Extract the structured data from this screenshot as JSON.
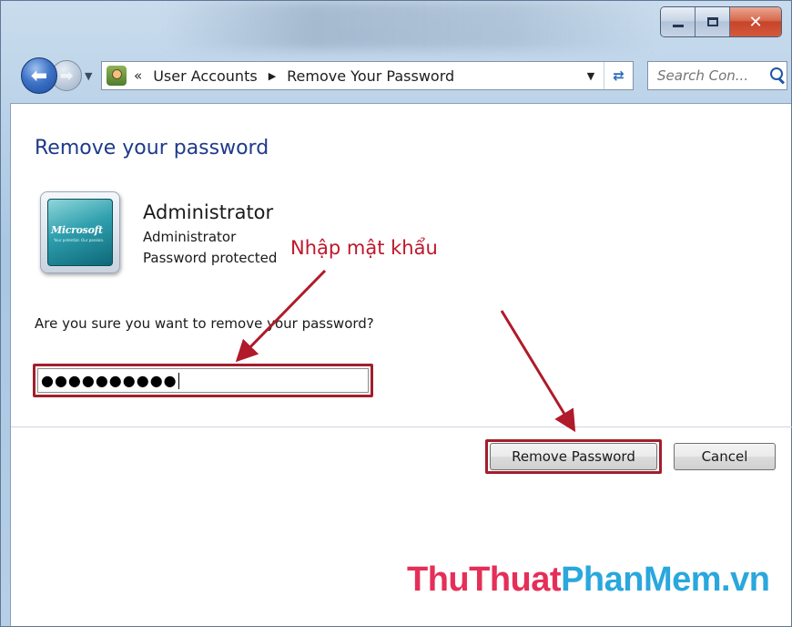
{
  "titlebar": {
    "minimize_label": "minimize",
    "maximize_label": "maximize",
    "close_label": "close"
  },
  "navigation": {
    "address_overflow": "«",
    "breadcrumbs": [
      "User Accounts",
      "Remove Your Password"
    ],
    "search_placeholder": "Search Con..."
  },
  "page": {
    "title": "Remove your password",
    "user": {
      "avatar_brand": "Microsoft",
      "avatar_tagline": "Your potential. Our passion.",
      "name": "Administrator",
      "role": "Administrator",
      "status": "Password protected"
    },
    "prompt": "Are you sure you want to remove your password?",
    "password_value": "●●●●●●●●●●",
    "buttons": {
      "remove": "Remove Password",
      "cancel": "Cancel"
    }
  },
  "annotation": {
    "label": "Nhập mật khẩu",
    "color": "#c0172b"
  },
  "watermark": {
    "part1": "ThuThuat",
    "part2": "PhanMem.vn"
  }
}
